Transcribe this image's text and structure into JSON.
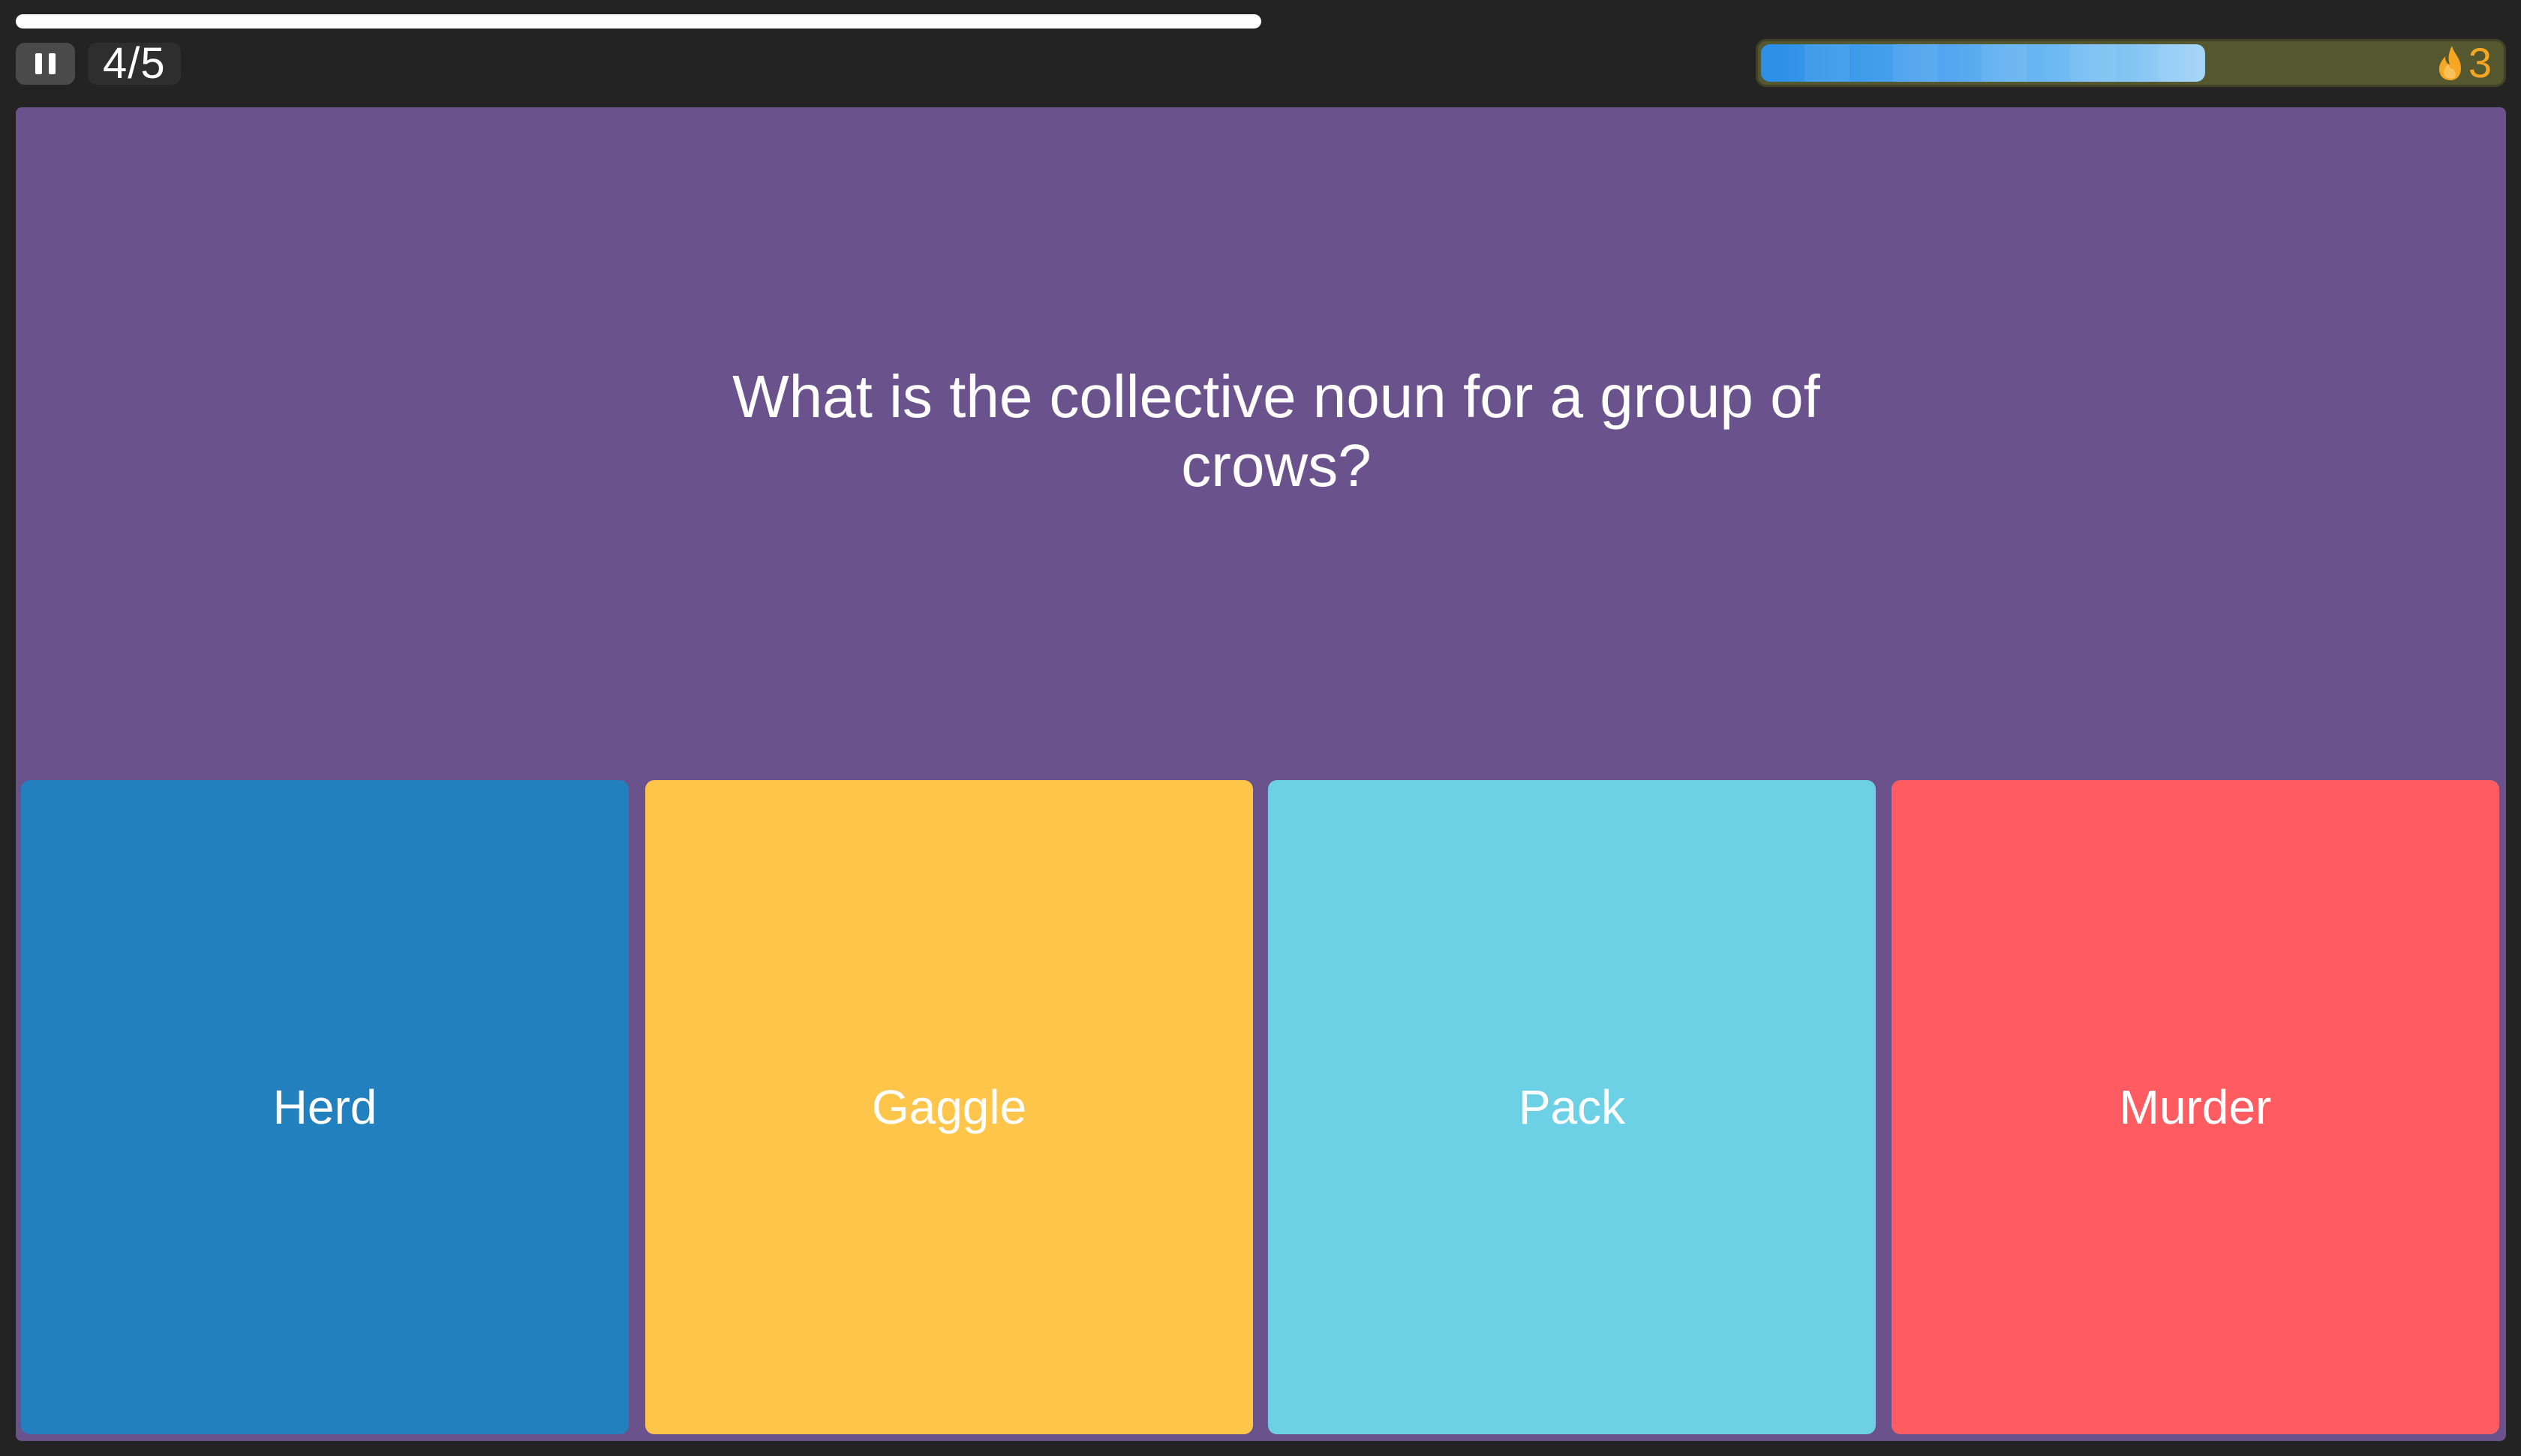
{
  "header": {
    "pause_icon": "pause-icon",
    "counter": "4/5",
    "streak": {
      "count": "3",
      "icon": "flame-icon",
      "icon_color": "#f5a623",
      "level": 0.6
    }
  },
  "question": {
    "text": "What is the collective noun for a group of crows?"
  },
  "answers": [
    {
      "label": "Herd",
      "color": "#2380be"
    },
    {
      "label": "Gaggle",
      "color": "#fec54b"
    },
    {
      "label": "Pack",
      "color": "#6dd1e5"
    },
    {
      "label": "Murder",
      "color": "#fe5c61"
    }
  ],
  "colors": {
    "background": "#232323",
    "panel": "#6a528d"
  }
}
